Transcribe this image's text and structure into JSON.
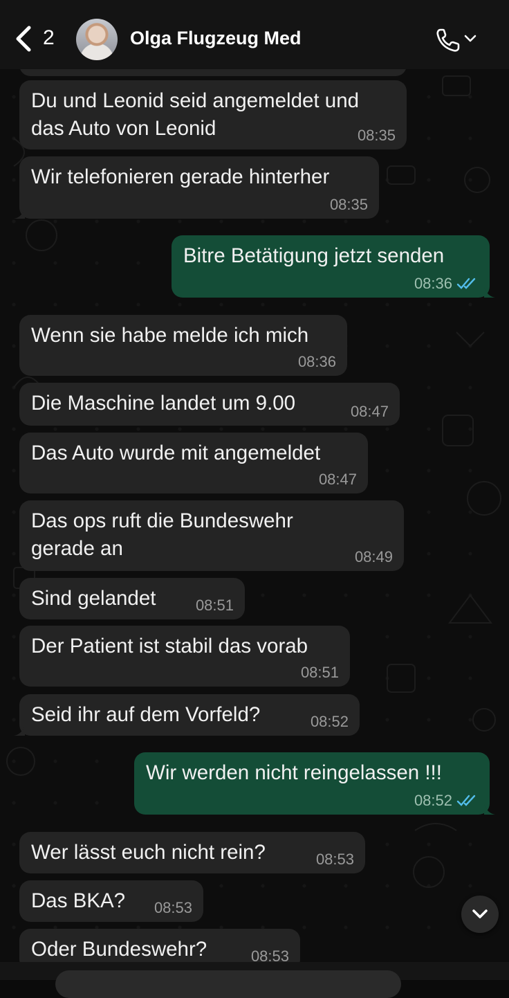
{
  "header": {
    "back_count": "2",
    "contact_name": "Olga Flugzeug Med"
  },
  "messages": [
    {
      "text": "Du und Leonid seid angemeldet und\ndas Auto von Leonid",
      "time": "08:35",
      "dir": "in"
    },
    {
      "text": "Wir telefonieren gerade hinterher",
      "time": "08:35",
      "dir": "in"
    },
    {
      "text": "Bitre Betätigung jetzt senden",
      "time": "08:36",
      "dir": "out",
      "status": "read"
    },
    {
      "text": "Wenn sie habe melde ich mich",
      "time": "08:36",
      "dir": "in"
    },
    {
      "text": "Die Maschine landet um 9.00",
      "time": "08:47",
      "dir": "in"
    },
    {
      "text": "Das Auto wurde mit angemeldet",
      "time": "08:47",
      "dir": "in"
    },
    {
      "text": "Das ops ruft die Bundeswehr\ngerade an",
      "time": "08:49",
      "dir": "in"
    },
    {
      "text": "Sind gelandet",
      "time": "08:51",
      "dir": "in"
    },
    {
      "text": "Der Patient ist stabil das vorab",
      "time": "08:51",
      "dir": "in"
    },
    {
      "text": "Seid ihr auf dem Vorfeld?",
      "time": "08:52",
      "dir": "in"
    },
    {
      "text": "Wir werden nicht reingelassen !!!",
      "time": "08:52",
      "dir": "out",
      "status": "read"
    },
    {
      "text": "Wer lässt euch nicht rein?",
      "time": "08:53",
      "dir": "in"
    },
    {
      "text": "Das BKA?",
      "time": "08:53",
      "dir": "in"
    },
    {
      "text": "Oder Bundeswehr?",
      "time": "08:53",
      "dir": "in"
    }
  ],
  "colors": {
    "incoming_bubble": "#242424",
    "outgoing_bubble": "#144d37",
    "read_ticks": "#53bdeb"
  }
}
